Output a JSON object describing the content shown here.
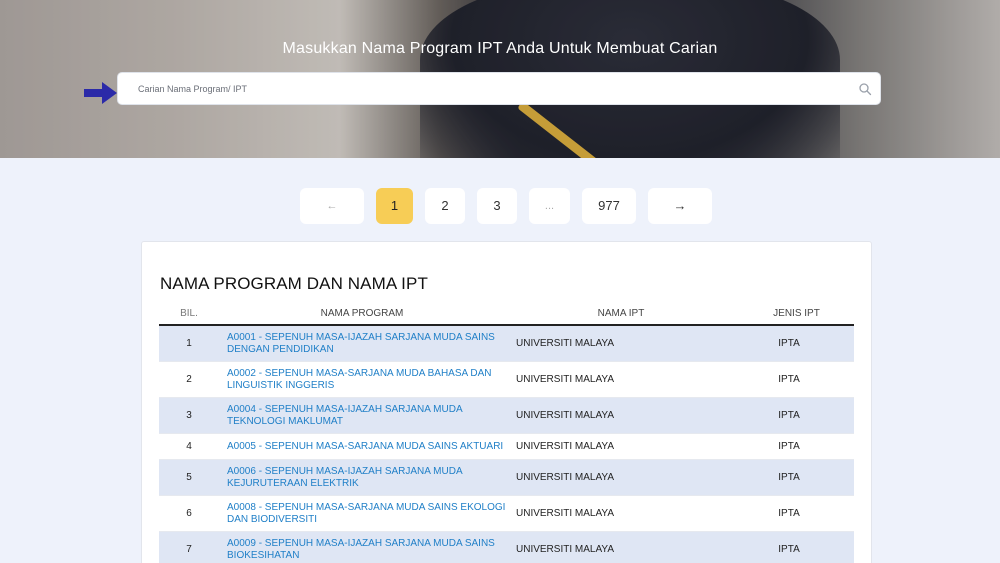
{
  "hero": {
    "title": "Masukkan Nama Program IPT Anda Untuk Membuat Carian",
    "search_placeholder": "Carian Nama Program/ IPT"
  },
  "pagination": {
    "prev": "←",
    "pages": [
      "1",
      "2",
      "3",
      "...",
      "977"
    ],
    "active": "1",
    "next": "→"
  },
  "table": {
    "title": "NAMA PROGRAM DAN NAMA IPT",
    "headers": [
      "BIL.",
      "NAMA PROGRAM",
      "NAMA IPT",
      "JENIS IPT"
    ],
    "rows": [
      {
        "bil": "1",
        "program": "A0001 - SEPENUH MASA-IJAZAH SARJANA MUDA SAINS DENGAN PENDIDIKAN",
        "ipt": "UNIVERSITI MALAYA",
        "jenis": "IPTA"
      },
      {
        "bil": "2",
        "program": "A0002 - SEPENUH MASA-SARJANA MUDA BAHASA DAN LINGUISTIK INGGERIS",
        "ipt": "UNIVERSITI MALAYA",
        "jenis": "IPTA"
      },
      {
        "bil": "3",
        "program": "A0004 - SEPENUH MASA-IJAZAH SARJANA MUDA TEKNOLOGI MAKLUMAT",
        "ipt": "UNIVERSITI MALAYA",
        "jenis": "IPTA"
      },
      {
        "bil": "4",
        "program": "A0005 - SEPENUH MASA-SARJANA MUDA SAINS AKTUARI",
        "ipt": "UNIVERSITI MALAYA",
        "jenis": "IPTA"
      },
      {
        "bil": "5",
        "program": "A0006 - SEPENUH MASA-IJAZAH SARJANA MUDA KEJURUTERAAN ELEKTRIK",
        "ipt": "UNIVERSITI MALAYA",
        "jenis": "IPTA"
      },
      {
        "bil": "6",
        "program": "A0008 - SEPENUH MASA-SARJANA MUDA SAINS EKOLOGI DAN BIODIVERSITI",
        "ipt": "UNIVERSITI MALAYA",
        "jenis": "IPTA"
      },
      {
        "bil": "7",
        "program": "A0009 - SEPENUH MASA-IJAZAH SARJANA MUDA SAINS BIOKESIHATAN",
        "ipt": "UNIVERSITI MALAYA",
        "jenis": "IPTA"
      }
    ]
  },
  "colors": {
    "active_page": "#f7cd56",
    "link": "#1f7fc7",
    "arrow": "#2b2aa8",
    "row_stripe": "#dfe6f4"
  },
  "icons": {
    "search": "search-icon",
    "pointer": "arrow-right-icon"
  }
}
